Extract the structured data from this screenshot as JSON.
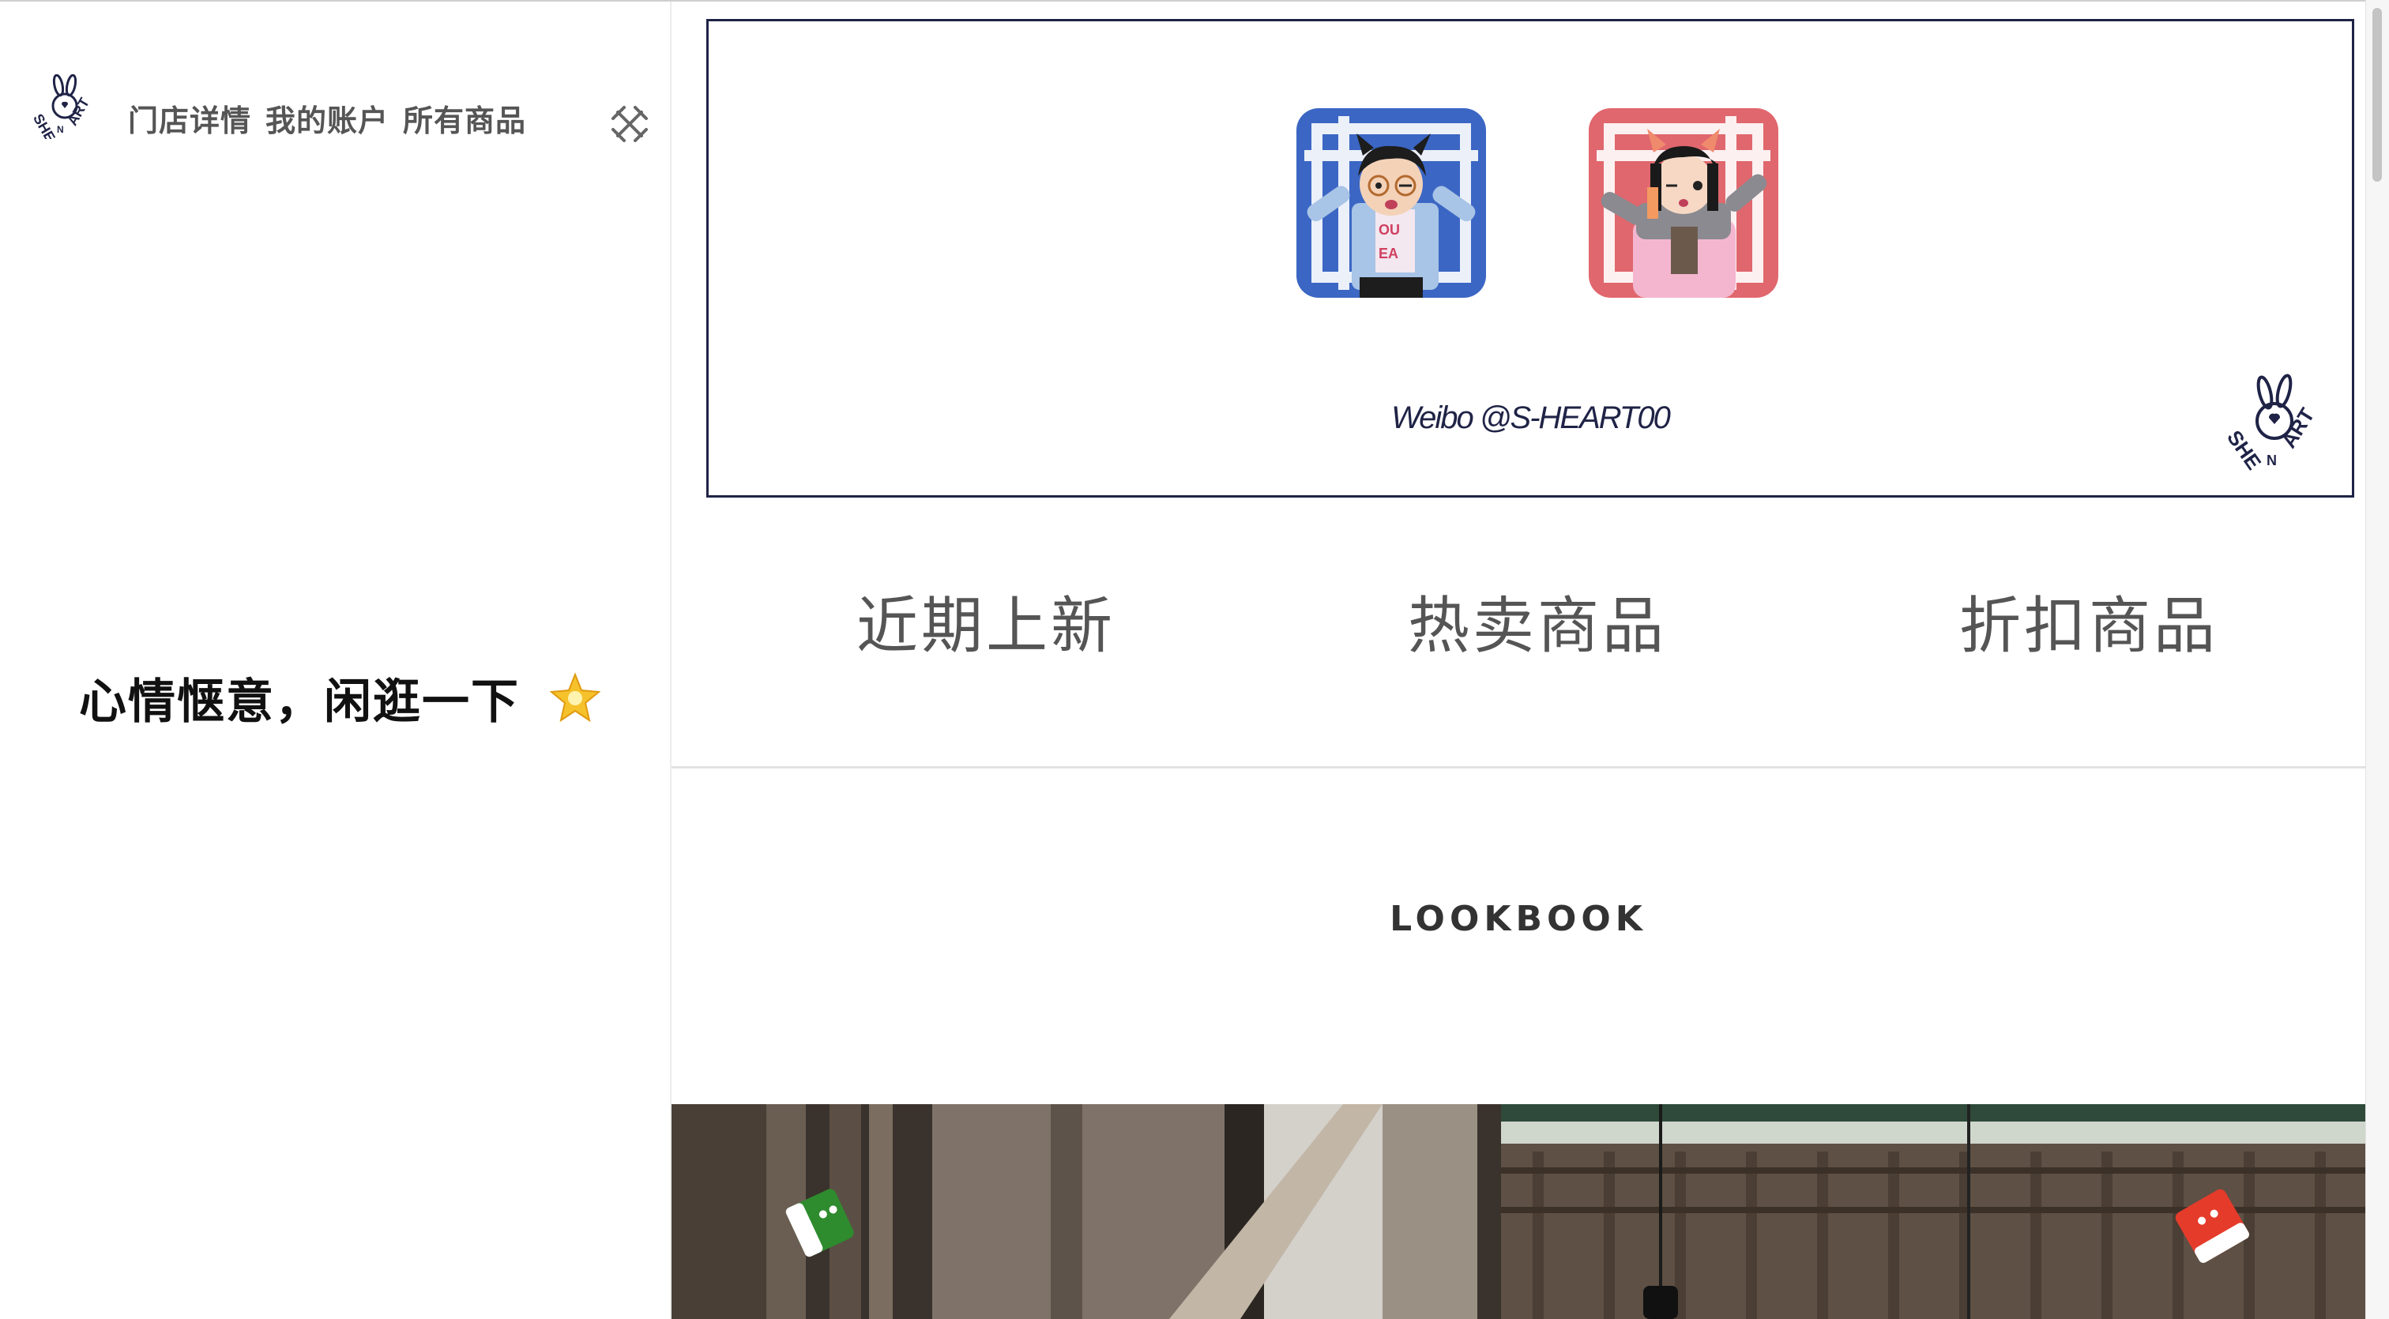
{
  "sidebar": {
    "nav": [
      {
        "label": "门店详情"
      },
      {
        "label": "我的账户"
      },
      {
        "label": "所有商品"
      }
    ],
    "tagline": "心情惬意，闲逛一下",
    "logo_icon": "shenart-bunny-logo",
    "close_icon": "close-icon",
    "star_icon": "glowing-star-icon"
  },
  "banner": {
    "weibo": "Weibo @S-HEART00",
    "avatar_colors": [
      "#3b66c4",
      "#e0676d"
    ]
  },
  "tabs": [
    {
      "label": "近期上新"
    },
    {
      "label": "热卖商品"
    },
    {
      "label": "折扣商品"
    }
  ],
  "lookbook": {
    "title": "LOOKBOOK"
  },
  "colors": {
    "accent": "#1f2346",
    "sticker_green": "#2e8b2e",
    "sticker_red": "#e53b2b"
  }
}
